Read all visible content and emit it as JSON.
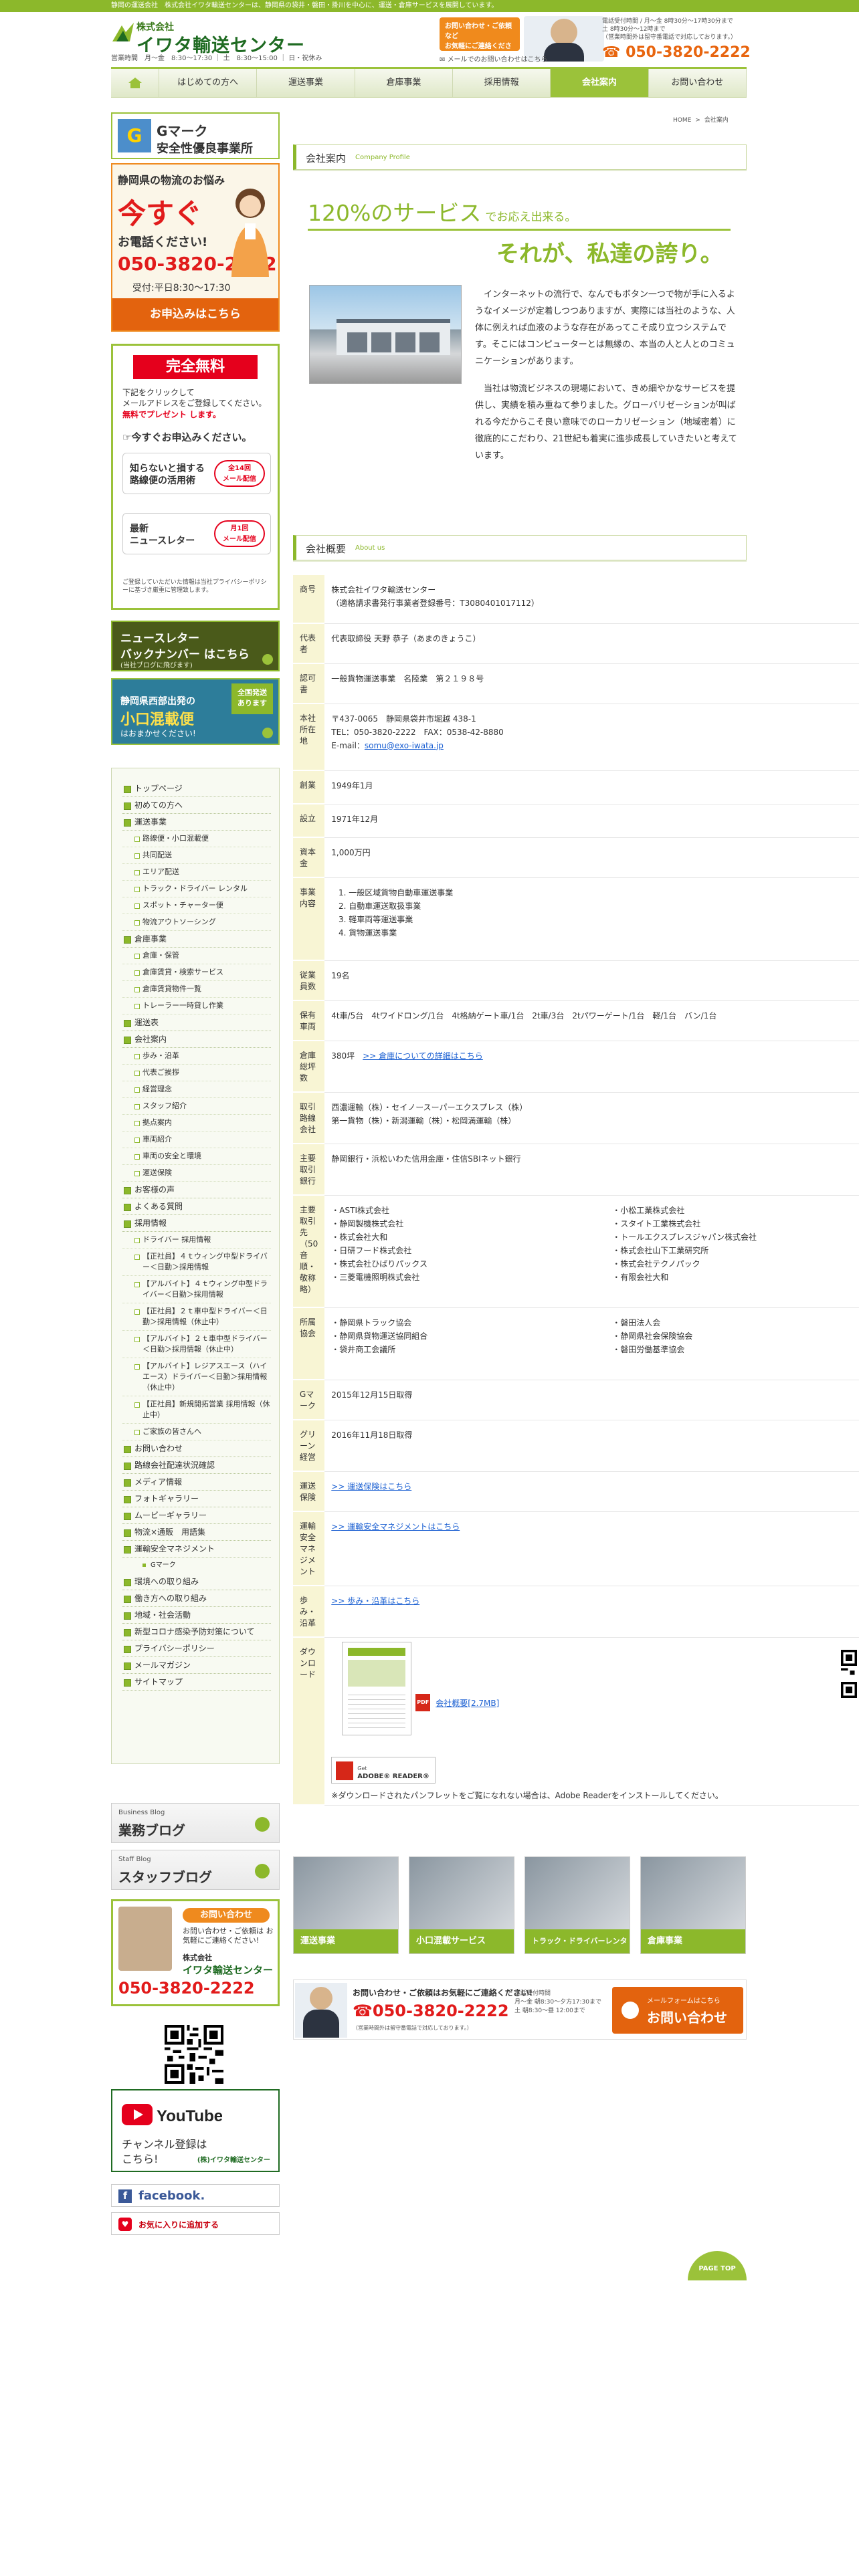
{
  "topbar": {
    "text": "静岡の運送会社　株式会社イワタ輸送センターは、静岡県の袋井・磐田・掛川を中心に、運送・倉庫サービスを展開しています。"
  },
  "header": {
    "company_prefix": "株式会社",
    "company_name": "イワタ輸送センター",
    "hours": "営業時間　月〜金　8:30〜17:30 ｜ 土　8:30〜15:00 ｜ 日・祝休み",
    "contact_banner": "お問い合わせ・ご依頼など\nお気軽にご連絡ください",
    "mail_link": "メールでのお問い合わせはこちら",
    "info": "電話受付時間 / 月〜金 8時30分〜17時30分まで\n土 8時30分〜12時まで\n（営業時間外は留守番電話で対応しております。）",
    "tel": "050-3820-2222"
  },
  "nav": {
    "items": [
      {
        "label": "はじめての方へ"
      },
      {
        "label": "運送事業"
      },
      {
        "label": "倉庫事業"
      },
      {
        "label": "採用情報"
      },
      {
        "label": "会社案内"
      },
      {
        "label": "お問い合わせ"
      }
    ]
  },
  "breadcrumb": {
    "home": "HOME",
    "sep": ">",
    "current": "会社案内"
  },
  "sidebar": {
    "gmark": {
      "mark": "G",
      "line1": "Gマーク",
      "line2": "安全性優良事業所"
    },
    "phone": {
      "lead": "静岡県の物流のお悩み",
      "now": "今すぐ",
      "call": "お電話ください!",
      "tel": "050-3820-2222",
      "hours": "受付:平日8:30〜17:30",
      "apply": "お申込みはこちら"
    },
    "free": {
      "ribbon": "完全無料",
      "desc": "下記をクリックして\nメールアドレスをご登録してください。",
      "present": "無料でプレゼント します。",
      "apply_now": "今すぐお申込みください。",
      "card1": {
        "title": "知らないと損する\n路線便の活用術",
        "badge": "全14回\nメール配信"
      },
      "card2": {
        "title": "最新\nニュースレター",
        "badge": "月1回\nメール配信"
      },
      "note": "ご登録していただいた情報は当社プライバシーポリシーに基づき厳重に管理致します。"
    },
    "newsletter": {
      "line1": "ニュースレター",
      "line2": "バックナンバー はこちら",
      "line3": "(当社ブログに飛びます)"
    },
    "kozumi": {
      "line1": "静岡県西部出発の",
      "line2": "小口混載便",
      "line3": "はおまかせください!",
      "badge": "全国発送\nあります"
    },
    "menu": [
      {
        "label": "トップページ",
        "level": 0
      },
      {
        "label": "初めての方へ",
        "level": 0
      },
      {
        "label": "運送事業",
        "level": 0
      },
      {
        "label": "路線便・小口混載便",
        "level": 1
      },
      {
        "label": "共同配送",
        "level": 1
      },
      {
        "label": "エリア配送",
        "level": 1
      },
      {
        "label": "トラック・ドライバー レンタル",
        "level": 1
      },
      {
        "label": "スポット・チャーター便",
        "level": 1
      },
      {
        "label": "物流アウトソーシング",
        "level": 1
      },
      {
        "label": "倉庫事業",
        "level": 0
      },
      {
        "label": "倉庫・保管",
        "level": 1
      },
      {
        "label": "倉庫賃貸・検索サービス",
        "level": 1
      },
      {
        "label": "倉庫賃貸物件一覧",
        "level": 1
      },
      {
        "label": "トレーラー一時貸し作業",
        "level": 1
      },
      {
        "label": "運送表",
        "level": 0
      },
      {
        "label": "会社案内",
        "level": 0
      },
      {
        "label": "歩み・沿革",
        "level": 1
      },
      {
        "label": "代表ご挨拶",
        "level": 1
      },
      {
        "label": "経営理念",
        "level": 1
      },
      {
        "label": "スタッフ紹介",
        "level": 1
      },
      {
        "label": "拠点案内",
        "level": 1
      },
      {
        "label": "車両紹介",
        "level": 1
      },
      {
        "label": "車両の安全と環境",
        "level": 1
      },
      {
        "label": "運送保険",
        "level": 1
      },
      {
        "label": "お客様の声",
        "level": 0
      },
      {
        "label": "よくある質問",
        "level": 0
      },
      {
        "label": "採用情報",
        "level": 0
      },
      {
        "label": "ドライバー 採用情報",
        "level": 1
      },
      {
        "label": "【正社員】４ｔウィング中型ドライバー＜日勤＞採用情報",
        "level": 1
      },
      {
        "label": "【アルバイト】４ｔウィング中型ドライバー＜日勤＞採用情報",
        "level": 1
      },
      {
        "label": "【正社員】２ｔ車中型ドライバー＜日勤＞採用情報（休止中）",
        "level": 1
      },
      {
        "label": "【アルバイト】２ｔ車中型ドライバー＜日勤＞採用情報（休止中）",
        "level": 1
      },
      {
        "label": "【アルバイト】レジアスエース（ハイエース）ドライバー＜日勤＞採用情報（休止中）",
        "level": 1
      },
      {
        "label": "【正社員】新規開拓営業 採用情報（休止中）",
        "level": 1
      },
      {
        "label": "ご家族の皆さんへ",
        "level": 1
      },
      {
        "label": "お問い合わせ",
        "level": 0
      },
      {
        "label": "路線会社配達状況確認",
        "level": 0
      },
      {
        "label": "メディア情報",
        "level": 0
      },
      {
        "label": "フォトギャラリー",
        "level": 0
      },
      {
        "label": "ムービーギャラリー",
        "level": 0
      },
      {
        "label": "物流×通販　用語集",
        "level": 0
      },
      {
        "label": "運輸安全マネジメント",
        "level": 0
      },
      {
        "label": "Gマーク",
        "level": 2
      },
      {
        "label": "環境への取り組み",
        "level": 0
      },
      {
        "label": "働き方への取り組み",
        "level": 0
      },
      {
        "label": "地域・社会活動",
        "level": 0
      },
      {
        "label": "新型コロナ感染予防対策について",
        "level": 0
      },
      {
        "label": "プライバシーポリシー",
        "level": 0
      },
      {
        "label": "メールマガジン",
        "level": 0
      },
      {
        "label": "サイトマップ",
        "level": 0
      }
    ],
    "blog1": {
      "en": "Business Blog",
      "jp": "業務ブログ"
    },
    "blog2": {
      "en": "Staff Blog",
      "jp": "スタッフブログ"
    },
    "staff_contact": {
      "pill": "お問い合わせ",
      "desc": "お問い合わせ・ご依頼は お気軽にご連絡ください!",
      "co": "株式会社",
      "name": "イワタ輸送センター",
      "tel": "050-3820-2222"
    },
    "youtube": {
      "logo": "YouTube",
      "text": "チャンネル登録は こちら!",
      "sub": "(株)イワタ輸送センター"
    },
    "facebook": {
      "icon": "f",
      "text": "facebook."
    },
    "favorite": {
      "icon": "♥",
      "text": "お気に入りに追加する"
    }
  },
  "main": {
    "profile_heading": {
      "jp": "会社案内",
      "en": "Company Profile"
    },
    "catch1": {
      "big": "120%のサービス",
      "small": "でお応え出来る。"
    },
    "catch2": "それが、私達の誇り。",
    "intro": [
      "インターネットの流行で、なんでもボタン一つで物が手に入るようなイメージが定着しつつありますが、実際には当社のような、人体に例えれば血液のような存在があってこそ成り立つシステムです。そこにはコンピューターとは無縁の、本当の人と人とのコミュニケーションがあります。",
      "当社は物流ビジネスの現場において、きめ細やかなサービスを提供し、実績を積み重ねて参りました。グローバリゼーションが叫ばれる今だからこそ良い意味でのローカリゼーション（地域密着）に徹底的にこだわり、21世紀も着実に進歩成長していきたいと考えています。"
    ],
    "overview_heading": {
      "jp": "会社概要",
      "en": "About us"
    },
    "table": {
      "name": {
        "label": "商号",
        "value1": "株式会社イワタ輸送センター",
        "value2": "（適格請求書発行事業者登録番号：T3080401017112）"
      },
      "rep": {
        "label": "代表者",
        "value": "代表取締役 天野 恭子（あまのきょうこ）"
      },
      "license": {
        "label": "認可書",
        "value": "一般貨物運送事業　名陸業　第２１９８号"
      },
      "hq": {
        "label": "本社所在地",
        "addr": "〒437-0065　静岡県袋井市堀越 438-1",
        "tel": "TEL：050-3820-2222　FAX：0538-42-8880",
        "mail_label": "E-mail：",
        "mail": "somu@exo-iwata.jp"
      },
      "founded": {
        "label": "創業",
        "value": "1949年1月"
      },
      "established": {
        "label": "設立",
        "value": "1971年12月"
      },
      "capital": {
        "label": "資本金",
        "value": "1,000万円"
      },
      "business": {
        "label": "事業内容",
        "items": [
          "一般区域貨物自動車運送事業",
          "自動車運送取扱事業",
          "軽車両等運送事業",
          "貨物運送事業"
        ]
      },
      "staff": {
        "label": "従業員数",
        "value": "19名"
      },
      "vehicles": {
        "label": "保有車両",
        "value": "4t車/5台　4tワイドロング/1台　4t格納ゲート車/1台　2t車/3台　2tパワーゲート/1台　軽/1台　バン/1台"
      },
      "warehouse": {
        "label": "倉庫総坪数",
        "value": "380坪",
        "link": ">> 倉庫についての詳細はこちら"
      },
      "partners": {
        "label": "取引路線会社",
        "line1": "西濃運輸（株）・セイノースーパーエクスプレス（株）",
        "line2": "第一貨物（株）・新潟運輸（株）・松岡満運輸（株）"
      },
      "bank": {
        "label": "主要取引銀行",
        "value": "静岡銀行・浜松いわた信用金庫・住信SBIネット銀行"
      },
      "clients": {
        "label": "主要取引先\n（50音順・敬称略）",
        "left": [
          "ASTI株式会社",
          "静岡製機株式会社",
          "株式会社大和",
          "日研フード株式会社",
          "株式会社ひばりパックス",
          "三菱電機照明株式会社"
        ],
        "right": [
          "小松工業株式会社",
          "スタイト工業株式会社",
          "トールエクスプレスジャパン株式会社",
          "株式会社山下工業研究所",
          "株式会社テクノパック",
          "有限会社大和"
        ]
      },
      "associations": {
        "label": "所属協会",
        "left": [
          "静岡県トラック協会",
          "静岡県貨物運送協同組合",
          "袋井商工会議所"
        ],
        "right": [
          "磐田法人会",
          "静岡県社会保険協会",
          "磐田労働基準協会"
        ]
      },
      "gmark": {
        "label": "Gマーク",
        "value": "2015年12月15日取得"
      },
      "green": {
        "label": "グリーン経営",
        "value": "2016年11月18日取得"
      },
      "insurance": {
        "label": "運送保険",
        "link": ">> 運送保険はこちら"
      },
      "safety": {
        "label": "運輸安全マネジメント",
        "link": ">> 運輸安全マネジメントはこちら"
      },
      "history": {
        "label": "歩み・沿革",
        "link": ">> 歩み・沿革はこちら"
      },
      "download": {
        "label": "ダウンロード",
        "pdf_icon": "PDF",
        "link": "会社概要[2.7MB]",
        "reader_get": "Get",
        "reader": "ADOBE® READER®",
        "note": "※ダウンロードされたパンフレットをご覧になれない場合は、Adobe Readerをインストールしてください。"
      }
    },
    "banners": [
      {
        "label": "運送事業"
      },
      {
        "label": "小口混載サービス"
      },
      {
        "label": "トラック・ドライバーレンタル"
      },
      {
        "label": "倉庫事業"
      }
    ],
    "footer_contact": {
      "title": "お問い合わせ・ご依頼はお気軽にご連絡ください!",
      "tel": "050-3820-2222",
      "sub": "（営業時間外は留守番電話で対応しております。）",
      "hours": "電話受付時間\n月〜金 朝8:30〜夕方17:30まで\n土 朝8:30〜昼 12:00まで",
      "btn_small": "メールフォームはこちら",
      "btn_big": "お問い合わせ"
    },
    "pagetop": "PAGE TOP"
  },
  "colors": {
    "brand_green": "#8cb82b",
    "accent_orange": "#e3630e",
    "tel_red": "#e11b1b",
    "table_head": "#f8f5d4"
  }
}
